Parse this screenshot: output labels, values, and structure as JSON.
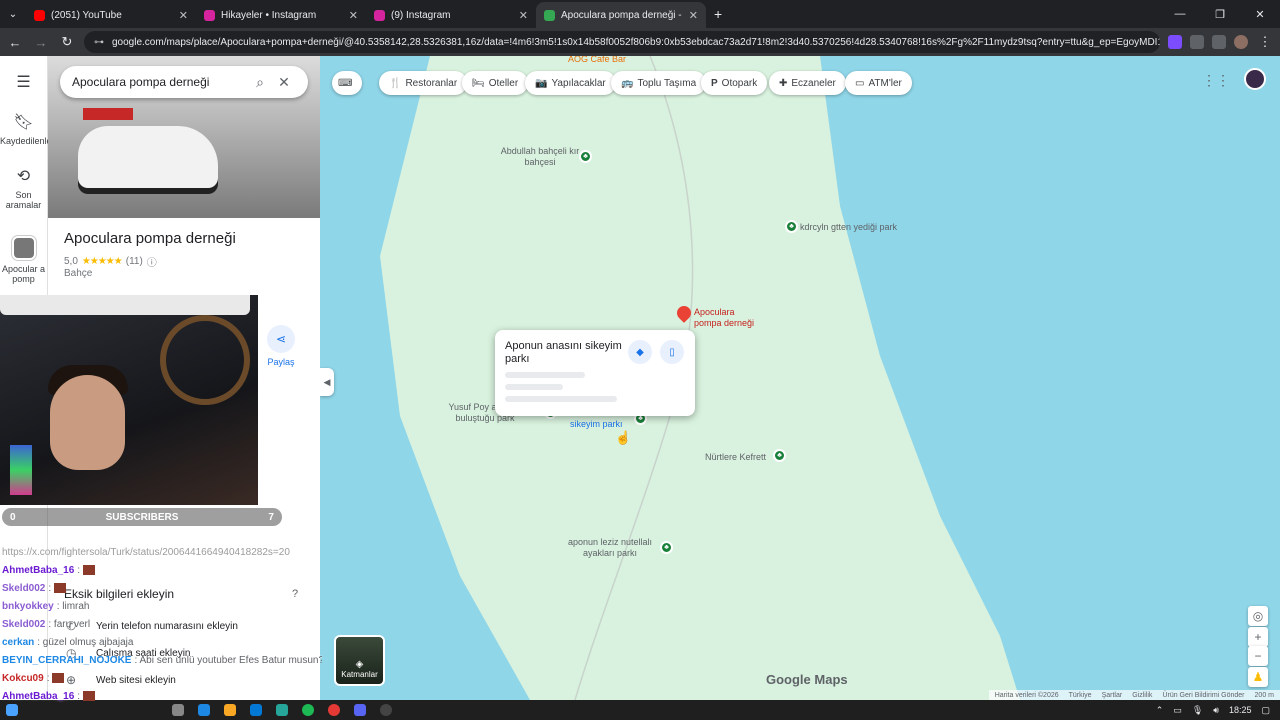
{
  "browser": {
    "tabs": [
      {
        "title": "(2051) YouTube",
        "color": "#ff0000"
      },
      {
        "title": "Hikayeler • Instagram",
        "color": "#d6249f"
      },
      {
        "title": "(9) Instagram",
        "color": "#d6249f"
      },
      {
        "title": "Apoculara pompa derneği - Go",
        "color": "#34a853"
      }
    ],
    "new_tab": "+",
    "url": "google.com/maps/place/Apoculara+pompa+derneği/@40.5358142,28.5326381,16z/data=!4m6!3m5!1s0x14b58f0052f806b9:0xb53ebdcac73a2d71!8m2!3d40.5370256!4d28.5340768!16s%2Fg%2F11mydz9tsq?entry=ttu&g_ep=EgoyMDI1..."
  },
  "rail": {
    "saved": "Kaydedilenler",
    "recent": "Son aramalar",
    "current": "Apocular a pomp"
  },
  "panel": {
    "search_query": "Apocularа pompa derneği",
    "place_title": "Apoculara pompa derneği",
    "rating": "5,0",
    "stars": "★★★★★",
    "review_count": "(11)",
    "category": "Bahçe",
    "share_label": "Paylaş",
    "missing_title": "Eksik bilgileri ekleyin",
    "missing_items": [
      "Yerin telefon numarasını ekleyin",
      "Çalışma saati ekleyin",
      "Web sitesi ekleyin"
    ]
  },
  "overlay": {
    "subs_count": "0",
    "subs_label": "SUBSCRIBERS",
    "subs_goal": "7"
  },
  "chat": [
    {
      "user": "https://x.com/fightersola/Turk/status/2006441664940418282s=20",
      "msg": "",
      "color": "#9b9b9b"
    },
    {
      "user": "AhmetBaba_16",
      "msg": ":",
      "color": "#6a1bd1"
    },
    {
      "user": "Skeld002",
      "msg": ":",
      "color": "#8a5cd1"
    },
    {
      "user": "bnkyokkey",
      "msg": ": limrah",
      "color": "#8a5cd1"
    },
    {
      "user": "Skeld002",
      "msg": ": faru verl",
      "color": "#8a5cd1"
    },
    {
      "user": "cerkan",
      "msg": ": güzel olmuş ajbajaja",
      "color": "#1e88e5"
    },
    {
      "user": "BEYIN_CERRAHI_NOJOKE",
      "msg": ": Abi sen ünlü youtuber Efes Batur musun?",
      "color": "#1e88e5"
    },
    {
      "user": "Kokcu09",
      "msg": ":",
      "color": "#c62828"
    },
    {
      "user": "AhmetBaba_16",
      "msg": ":",
      "color": "#6a1bd1"
    }
  ],
  "map": {
    "chips": [
      {
        "icon": "🍴",
        "label": "Restoranlar"
      },
      {
        "icon": "🛏",
        "label": "Oteller"
      },
      {
        "icon": "📷",
        "label": "Yapılacaklar"
      },
      {
        "icon": "🚌",
        "label": "Toplu Taşıma"
      },
      {
        "icon": "P",
        "label": "Otopark"
      },
      {
        "icon": "✚",
        "label": "Eczaneler"
      },
      {
        "icon": "▭",
        "label": "ATM'ler"
      }
    ],
    "pois": [
      {
        "label": "AOG Cafe Bar"
      },
      {
        "label": "Abdullah bahçeli kır bahçesi"
      },
      {
        "label": "kdrcyln gtten yediği park"
      },
      {
        "label": "Yusuf Poy aponun buluştuğu park"
      },
      {
        "label": "sikeyim parkı"
      },
      {
        "label": "Nürtlere Kefrett"
      },
      {
        "label": "aponun leziz nutellalı ayakları parkı"
      }
    ],
    "place_label": "Apoculara pompa derneği",
    "popup_title": "Aponun anasını sikeyim parkı",
    "layers_label": "Katmanlar",
    "logo": "Google Maps",
    "attribution": [
      "Harita verileri ©2026",
      "Türkiye",
      "Şartlar",
      "Gizlilik",
      "Ürün Geri Bildirimi Gönder",
      "200 m"
    ]
  },
  "taskbar": {
    "time": "18:25"
  }
}
